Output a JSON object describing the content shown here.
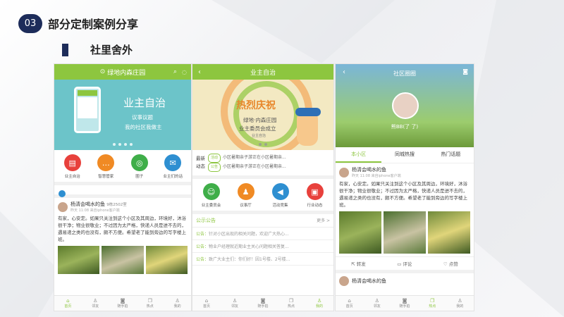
{
  "slide": {
    "number": "03",
    "title": "部分定制案例分享",
    "subtitle": "社里舍外"
  },
  "phone1": {
    "header_title": "绿地内森庄园",
    "banner": {
      "title": "业主自治",
      "line1": "议事议题",
      "line2": "我的社区我做主"
    },
    "icons": [
      {
        "label": "业主自治",
        "color": "#e8413c",
        "icon": "clipboard-icon",
        "glyph": "▤"
      },
      {
        "label": "智慧管家",
        "color": "#f08a24",
        "icon": "chat-icon",
        "glyph": "…"
      },
      {
        "label": "圈子",
        "color": "#3fae49",
        "icon": "circle-icon",
        "glyph": "◎"
      },
      {
        "label": "业主们的话",
        "color": "#2e8fd1",
        "icon": "megaphone-icon",
        "glyph": "✉"
      }
    ],
    "post": {
      "author": "杨清会喝水的鱼",
      "meta_line": "9栋2502室",
      "time": "昨天 11:08 来自iphone客户端",
      "text": "有家，心安定。如果只关注到这个小区及其周边，环境好，沐浴很干净；物业很敬业；不过因为太严格，快递人员是进不去的，遇易递之类的也没有，颇不方便。希望老了能到旁边的写字楼上班。"
    },
    "tabs": [
      "首页",
      "邻友",
      "随手拍",
      "热点",
      "我的"
    ]
  },
  "phone2": {
    "header_title": "业主自治",
    "banner": {
      "title": "热烈庆祝",
      "line1": "绿地·内森庄园",
      "line2": "业主委员会成立",
      "line3": "业主自治"
    },
    "news": {
      "label_top": "最新",
      "label_bottom": "动态",
      "items": [
        {
          "tag": "活动",
          "text": "小区暑期亲子游正在小区暑期亲..."
        },
        {
          "tag": "公告",
          "text": "小区暑期亲子游正在小区暑期亲..."
        }
      ]
    },
    "icons": [
      {
        "label": "业主委员会",
        "color": "#3fae49",
        "icon": "people-icon",
        "glyph": "☺"
      },
      {
        "label": "议事厅",
        "color": "#f08a24",
        "icon": "discuss-icon",
        "glyph": "♟"
      },
      {
        "label": "活动竞集",
        "color": "#2e8fd1",
        "icon": "megaphone-icon",
        "glyph": "◀"
      },
      {
        "label": "行业动态",
        "color": "#e8413c",
        "icon": "document-icon",
        "glyph": "▣"
      }
    ],
    "announce": {
      "heading": "公示公告",
      "more": "更多 >",
      "items": [
        {
          "prefix": "公告：",
          "text": "针对小区出现的相关问题，欢迎广大热心..."
        },
        {
          "prefix": "公告：",
          "text": "物业户经理就近期业主关心问题相关答复..."
        },
        {
          "prefix": "公告：",
          "text": "致广大业主们：你们好！因1号楼、2号楼..."
        }
      ]
    },
    "tabs": [
      "首页",
      "邻友",
      "随手拍",
      "热点",
      "我的"
    ]
  },
  "phone3": {
    "header_title": "社区圈圈",
    "user_name": "熊BB(了 了)",
    "segments": [
      "本小区",
      "同城热搜",
      "热门话题"
    ],
    "post": {
      "author": "杨清会喝水的鱼",
      "time": "昨天 11:08 来自iphone客户端",
      "text": "有家，心安定。如果只关注到这个小区及其周边，环境好，沐浴很干净；物业很敬业；不过因为太严格，快递人员是进不去的，遇易递之类的也没有，颇不方便。希望老了能到旁边的写字楼上班。"
    },
    "actions": [
      "转发",
      "评论",
      "点赞"
    ],
    "post2_author": "杨清会喝水的鱼",
    "tabs": [
      "首页",
      "邻友",
      "随手拍",
      "热点",
      "我的"
    ]
  }
}
